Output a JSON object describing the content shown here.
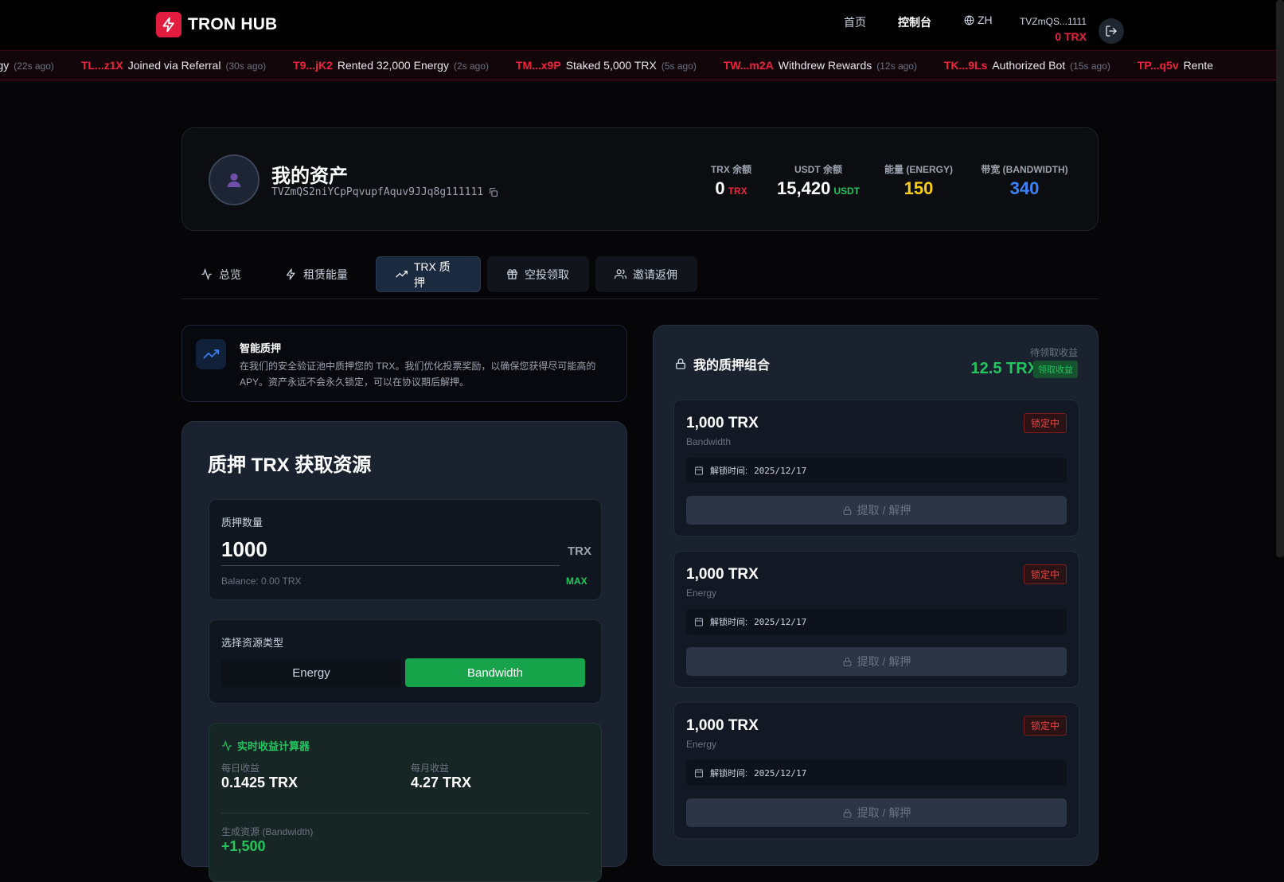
{
  "header": {
    "brand": "TRON HUB",
    "nav": [
      {
        "label": "首页"
      },
      {
        "label": "控制台"
      }
    ],
    "lang": "ZH",
    "address_short": "TVZmQS...1111",
    "trx_balance": "0 TRX"
  },
  "ticker": [
    {
      "addr": "",
      "msg": "ergy",
      "time": "(22s ago)"
    },
    {
      "addr": "TL...z1X",
      "msg": "Joined via Referral",
      "time": "(30s ago)"
    },
    {
      "addr": "T9...jK2",
      "msg": "Rented 32,000 Energy",
      "time": "(2s ago)"
    },
    {
      "addr": "TM...x9P",
      "msg": "Staked 5,000 TRX",
      "time": "(5s ago)"
    },
    {
      "addr": "TW...m2A",
      "msg": "Withdrew Rewards",
      "time": "(12s ago)"
    },
    {
      "addr": "TK...9Ls",
      "msg": "Authorized Bot",
      "time": "(15s ago)"
    },
    {
      "addr": "TP...q5v",
      "msg": "Rente",
      "time": ""
    }
  ],
  "assets": {
    "title": "我的资产",
    "address": "TVZmQS2niYCpPqvupfAquv9JJq8g111111",
    "stats": [
      {
        "label": "TRX 余额",
        "value": "0",
        "unit": "TRX",
        "color": "#ffffff",
        "unit_color": "#ef233c"
      },
      {
        "label": "USDT 余额",
        "value": "15,420",
        "unit": "USDT",
        "color": "#ffffff",
        "unit_color": "#22c55e"
      },
      {
        "label": "能量 (ENERGY)",
        "value": "150",
        "unit": "",
        "color": "#facc15",
        "unit_color": ""
      },
      {
        "label": "带宽 (BANDWIDTH)",
        "value": "340",
        "unit": "",
        "color": "#3b82f6",
        "unit_color": ""
      }
    ]
  },
  "tabs": [
    {
      "label": "总览",
      "icon": "activity-icon"
    },
    {
      "label": "租赁能量",
      "icon": "zap-icon"
    },
    {
      "label": "TRX 质押",
      "icon": "trending-up-icon"
    },
    {
      "label": "空投领取",
      "icon": "gift-icon"
    },
    {
      "label": "邀请返佣",
      "icon": "users-icon"
    }
  ],
  "info": {
    "title": "智能质押",
    "text": "在我们的安全验证池中质押您的 TRX。我们优化投票奖励，以确保您获得尽可能高的 APY。资产永远不会永久锁定，可以在协议期后解押。"
  },
  "stake": {
    "title": "质押 TRX 获取资源",
    "amount_label": "质押数量",
    "amount_value": "1000",
    "unit": "TRX",
    "balance": "Balance: 0.00 TRX",
    "max": "MAX",
    "resource_label": "选择资源类型",
    "options": [
      "Energy",
      "Bandwidth"
    ],
    "selected": "Bandwidth",
    "calc": {
      "title": "实时收益计算器",
      "daily_label": "每日收益",
      "daily_value": "0.1425 TRX",
      "monthly_label": "每月收益",
      "monthly_value": "4.27 TRX",
      "gen_label": "生成资源 (Bandwidth)",
      "gen_value": "+1,500"
    }
  },
  "portfolio": {
    "title": "我的质押组合",
    "pending_label": "待领取收益",
    "pending_value": "12.5 TRX",
    "claim_label": "领取收益",
    "positions": [
      {
        "amount": "1,000 TRX",
        "type": "Bandwidth",
        "status": "锁定中",
        "unlock_label": "解锁时间:",
        "unlock_date": "2025/12/17",
        "button": "提取 / 解押"
      },
      {
        "amount": "1,000 TRX",
        "type": "Energy",
        "status": "锁定中",
        "unlock_label": "解锁时间:",
        "unlock_date": "2025/12/17",
        "button": "提取 / 解押"
      },
      {
        "amount": "1,000 TRX",
        "type": "Energy",
        "status": "锁定中",
        "unlock_label": "解锁时间:",
        "unlock_date": "2025/12/17",
        "button": "提取 / 解押"
      }
    ]
  }
}
